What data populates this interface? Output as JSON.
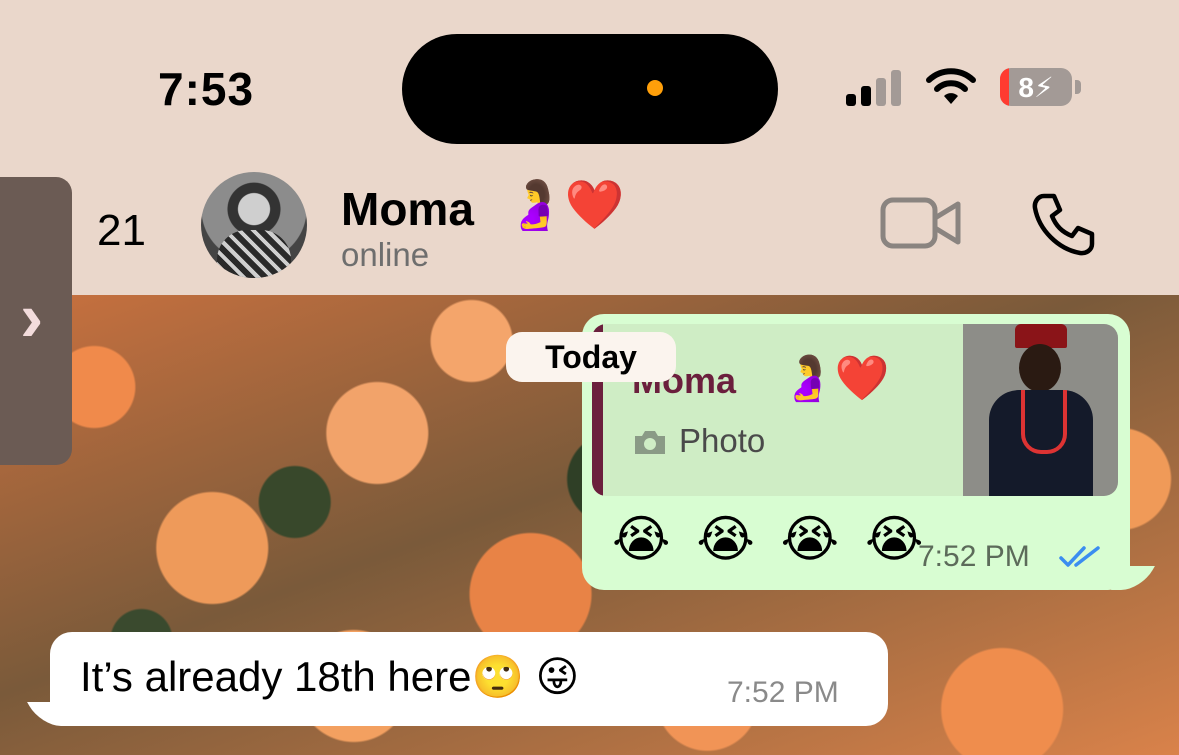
{
  "status_bar": {
    "time": "7:53",
    "battery": "8"
  },
  "header": {
    "back_count": "21",
    "contact_name": "Moma",
    "contact_emoji": "🤰❤️",
    "status": "online",
    "icons": [
      "video-camera-icon",
      "phone-icon",
      "avatar"
    ]
  },
  "chat": {
    "date_label": "Today",
    "outgoing": {
      "quote_name": "Moma",
      "quote_emoji": "🤰❤️",
      "quote_type": "Photo",
      "message": "😭 😭 😭 😭",
      "time": "7:52 PM",
      "status": "read"
    },
    "incoming": {
      "message": "It’s already 18th here🙄 😜",
      "time": "7:52 PM"
    }
  },
  "colors": {
    "header_bg": "#ead7cb",
    "outgoing_bubble": "#d8fdd2",
    "incoming_bubble": "#ffffff",
    "quote_accent": "#6b1f3d",
    "read_ticks": "#3b8df0",
    "battery_low": "#ff3b30"
  }
}
